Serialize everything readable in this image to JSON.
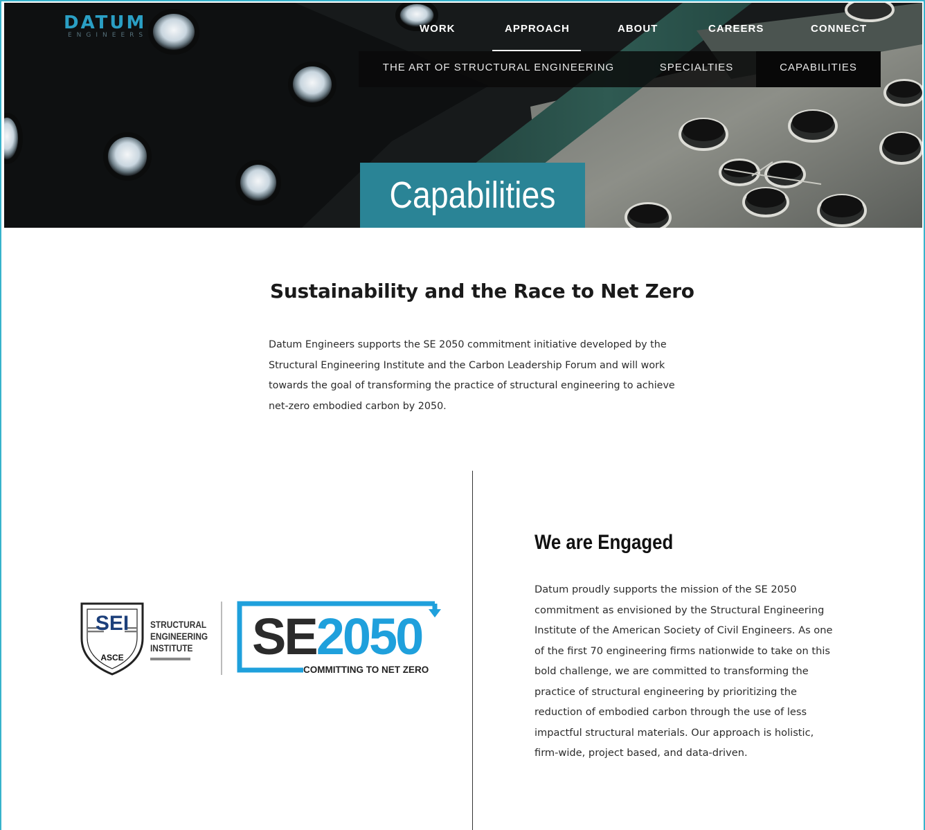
{
  "header": {
    "logo": {
      "word": "DATUM",
      "sub": "ENGINEERS"
    },
    "nav": [
      "WORK",
      "APPROACH",
      "ABOUT",
      "CAREERS",
      "CONNECT"
    ],
    "subnav": [
      "THE ART OF STRUCTURAL ENGINEERING",
      "SPECIALTIES",
      "CAPABILITIES"
    ],
    "page_title": "Capabilities"
  },
  "colors": {
    "accent_teal": "#2a8496",
    "logo_blue": "#2a9fc4",
    "frame_border": "#37b3cc",
    "se2050_blue": "#1fa0dc"
  },
  "intro": {
    "heading": "Sustainability and the Race to Net Zero",
    "body": "Datum Engineers supports the SE 2050 commitment initiative developed by the Structural Engineering Institute and the Carbon Leadership Forum and will work towards the goal of transforming the practice of structural engineering to achieve net-zero embodied carbon by 2050."
  },
  "logos": {
    "sei": {
      "badge": "SEI",
      "badge_sub": "ASCE",
      "label": "STRUCTURAL ENGINEERING INSTITUTE"
    },
    "se2050": {
      "prefix": "SE",
      "year": "2050",
      "tagline": "COMMITTING TO NET ZERO"
    }
  },
  "engaged": {
    "heading": "We are Engaged",
    "body": "Datum proudly supports the mission of the SE 2050 commitment as envisioned by the Structural Engineering Institute of the American Society of Civil Engineers. As one of the first 70 engineering firms nationwide to take on this bold challenge, we are committed to transforming the practice of structural engineering by prioritizing the reduction of embodied carbon through the use of less impactful structural materials. Our approach is holistic, firm-wide, project based, and data-driven."
  }
}
